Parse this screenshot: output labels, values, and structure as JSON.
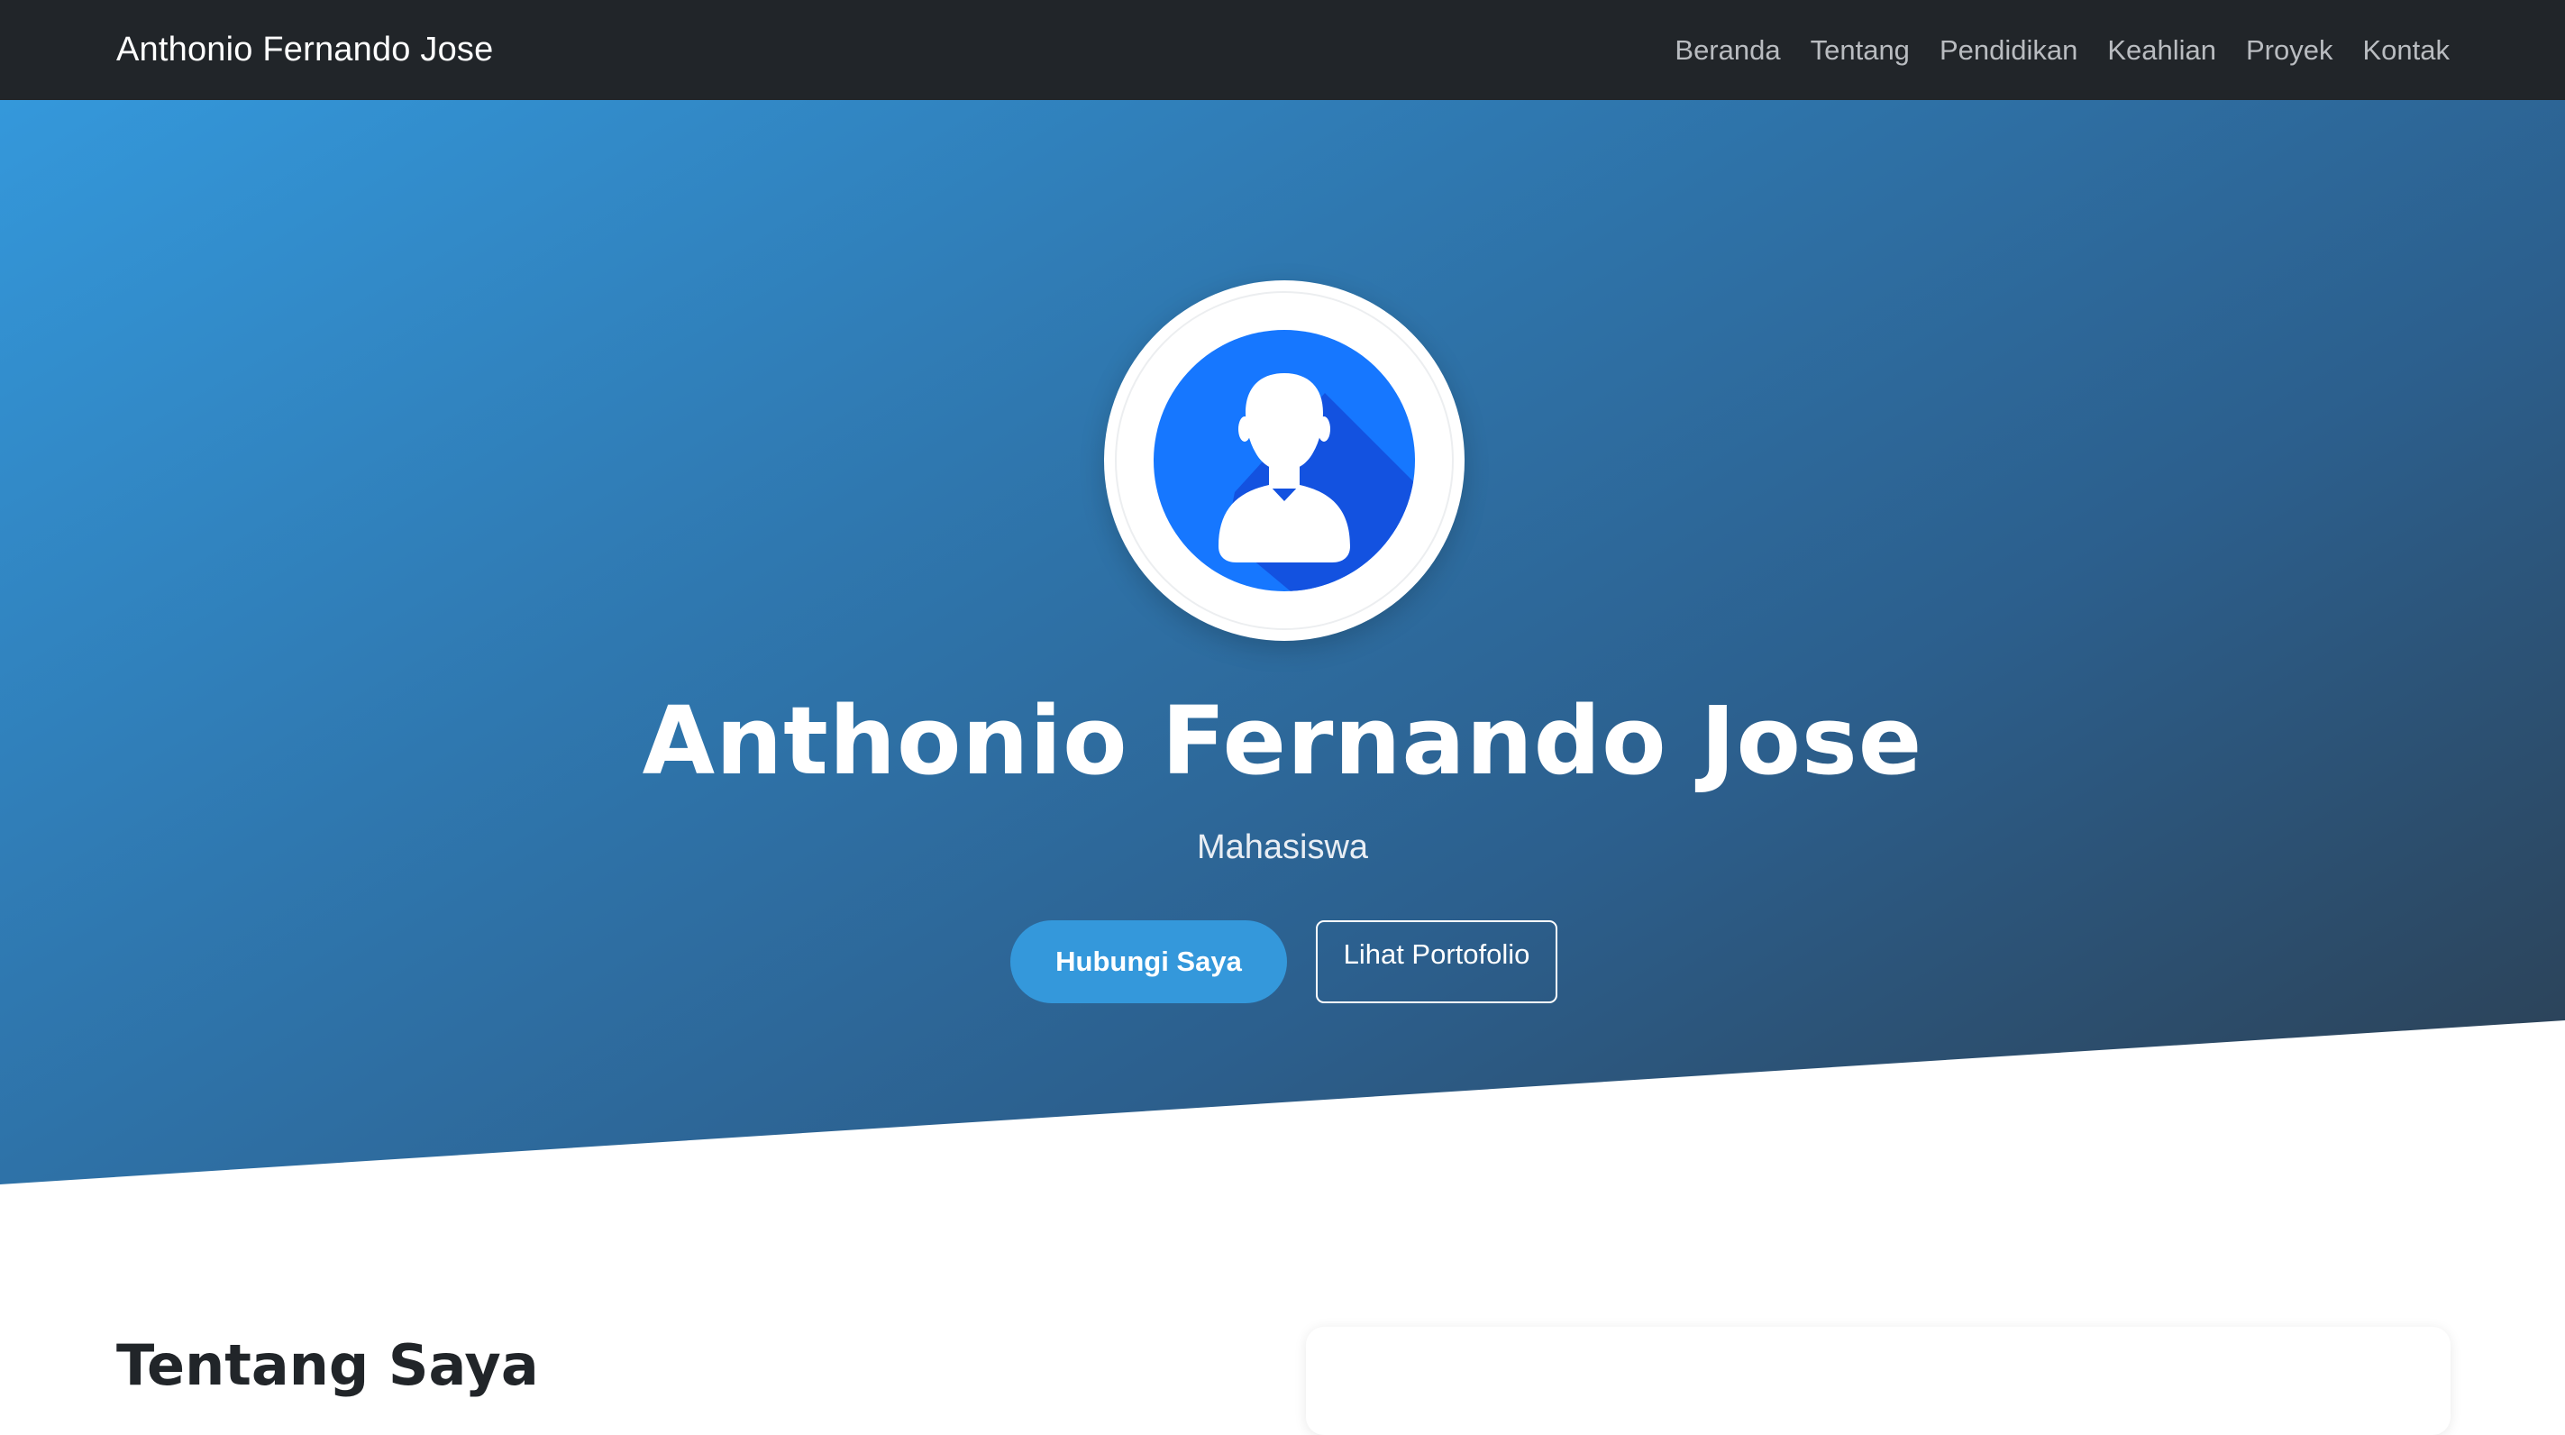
{
  "navbar": {
    "brand": "Anthonio Fernando Jose",
    "links": [
      {
        "label": "Beranda"
      },
      {
        "label": "Tentang"
      },
      {
        "label": "Pendidikan"
      },
      {
        "label": "Keahlian"
      },
      {
        "label": "Proyek"
      },
      {
        "label": "Kontak"
      }
    ]
  },
  "hero": {
    "avatar_icon": "user-silhouette-icon",
    "name": "Anthonio Fernando Jose",
    "title": "Mahasiswa",
    "primary_button": "Hubungi Saya",
    "secondary_button": "Lihat Portofolio"
  },
  "about": {
    "heading": "Tentang Saya"
  },
  "colors": {
    "navbar_bg": "#212529",
    "hero_gradient_start": "#3498db",
    "hero_gradient_end": "#2c3e50",
    "accent": "#3498db",
    "avatar_blue": "#1677ff"
  }
}
